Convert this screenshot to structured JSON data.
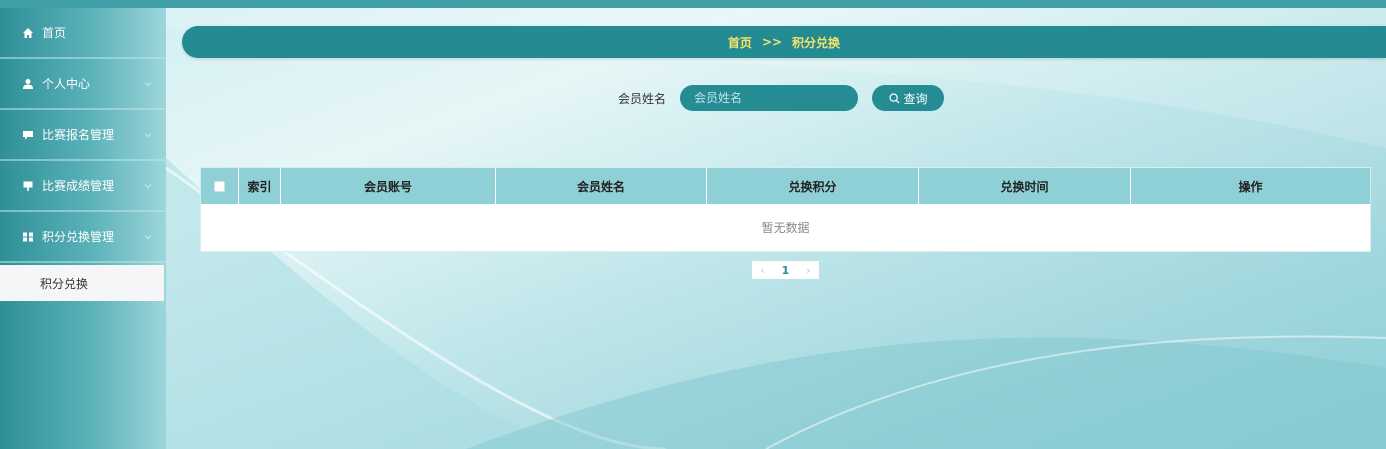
{
  "sidebar": {
    "items": [
      {
        "label": "首页",
        "icon": "home-icon",
        "has_arrow": false
      },
      {
        "label": "个人中心",
        "icon": "user-icon",
        "has_arrow": true
      },
      {
        "label": "比赛报名管理",
        "icon": "comment-icon",
        "has_arrow": true
      },
      {
        "label": "比赛成绩管理",
        "icon": "signboard-icon",
        "has_arrow": true
      },
      {
        "label": "积分兑换管理",
        "icon": "grid-icon",
        "has_arrow": true
      }
    ],
    "submenu": {
      "label": "积分兑换"
    }
  },
  "breadcrumb": {
    "home": "首页",
    "separator": ">>",
    "current": "积分兑换"
  },
  "search": {
    "label": "会员姓名",
    "placeholder": "会员姓名",
    "value": "",
    "button_label": "查询",
    "button_icon": "search-icon"
  },
  "table": {
    "columns": [
      "索引",
      "会员账号",
      "会员姓名",
      "兑换积分",
      "兑换时间",
      "操作"
    ],
    "rows": [],
    "empty_text": "暂无数据"
  },
  "pagination": {
    "current_page": "1",
    "prev": "‹",
    "next": "›"
  },
  "colors": {
    "accent": "#248b92",
    "breadcrumb_text": "#f7e36a",
    "table_header": "#8fd0d7"
  }
}
